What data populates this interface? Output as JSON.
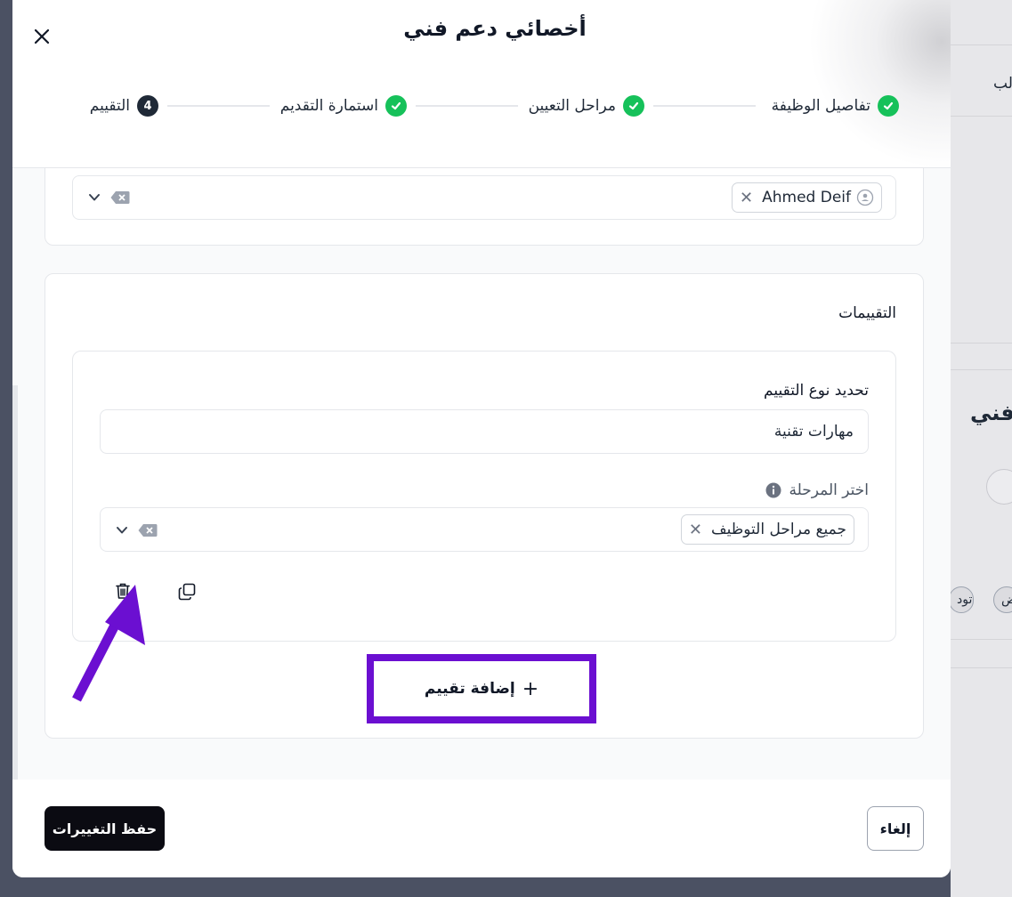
{
  "background": {
    "text_top": "لب",
    "text_title": "فني",
    "pill_1": "رض",
    "pill_2": "تود"
  },
  "modal": {
    "title": "أخصائي دعم فني",
    "steps": [
      {
        "label": "تفاصيل الوظيفة",
        "status": "done"
      },
      {
        "label": "مراحل التعيين",
        "status": "done"
      },
      {
        "label": "استمارة التقديم",
        "status": "done"
      },
      {
        "label": "التقييم",
        "status": "current",
        "number": "4"
      }
    ],
    "interviewer_select": {
      "chip": "Ahmed Deif"
    },
    "assessments": {
      "title": "التقييمات",
      "type_label": "تحديد نوع التقييم",
      "type_value": "مهارات تقنية",
      "stage_label": "اختر المرحلة",
      "stage_chip": "جميع مراحل التوظيف"
    },
    "add_button": "إضافة تقييم",
    "footer": {
      "save": "حفظ التغييرات",
      "cancel": "إلغاء"
    }
  },
  "colors": {
    "accent_green": "#16c15a",
    "annotation_purple": "#6b0fd1",
    "primary_dark": "#0b0b12"
  }
}
